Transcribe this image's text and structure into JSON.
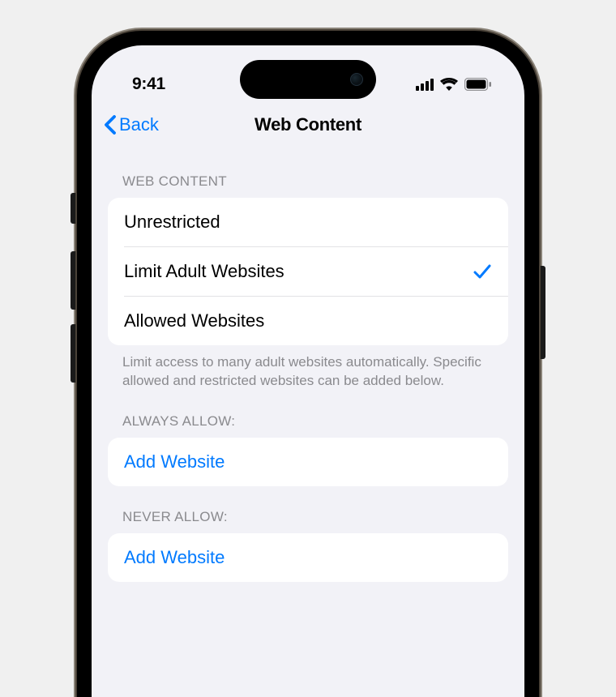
{
  "status": {
    "time": "9:41"
  },
  "nav": {
    "back_label": "Back",
    "title": "Web Content"
  },
  "sections": {
    "web_content": {
      "header": "WEB CONTENT",
      "options": [
        {
          "label": "Unrestricted",
          "selected": false
        },
        {
          "label": "Limit Adult Websites",
          "selected": true
        },
        {
          "label": "Allowed Websites",
          "selected": false
        }
      ],
      "footer": "Limit access to many adult websites automatically. Specific allowed and restricted websites can be added below."
    },
    "always_allow": {
      "header": "ALWAYS ALLOW:",
      "add_label": "Add Website"
    },
    "never_allow": {
      "header": "NEVER ALLOW:",
      "add_label": "Add Website"
    }
  }
}
